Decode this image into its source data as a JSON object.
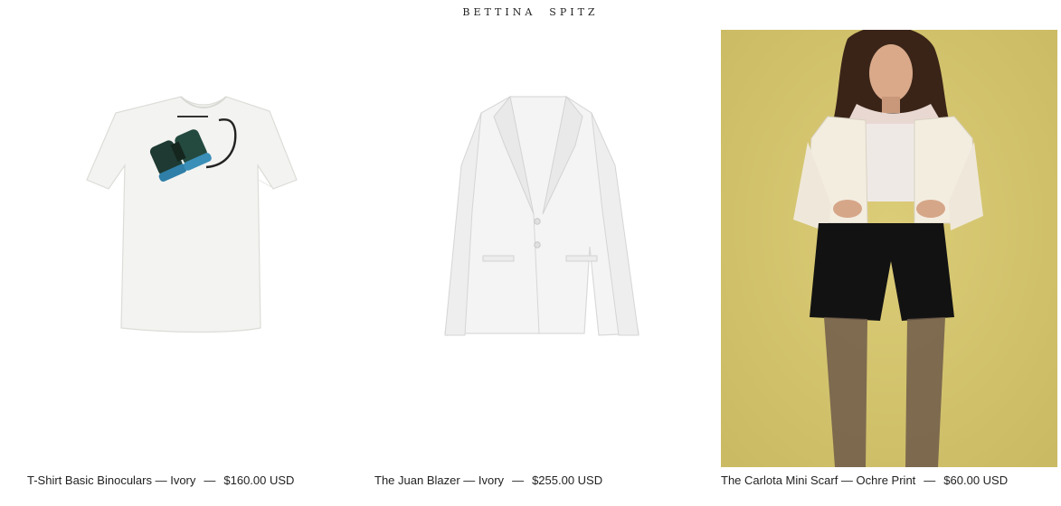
{
  "header": {
    "brand": "BETTINA  SPITZ"
  },
  "products": [
    {
      "name": "T-Shirt Basic Binoculars — Ivory",
      "separator": "—",
      "price": "$160.00 USD",
      "image": "white-tshirt-binoculars-print"
    },
    {
      "name": "The Juan Blazer — Ivory",
      "separator": "—",
      "price": "$255.00 USD",
      "image": "white-blazer"
    },
    {
      "name": "The Carlota Mini Scarf — Ochre Print",
      "separator": "—",
      "price": "$60.00 USD",
      "image": "model-ivory-jacket-scarf-on-ochre"
    }
  ],
  "colors": {
    "ochre_background": "#d6c66e",
    "ivory": "#f4f2ee",
    "text": "#222222"
  }
}
